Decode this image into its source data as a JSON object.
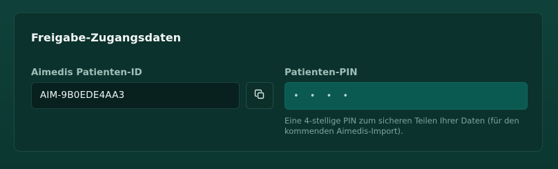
{
  "card": {
    "title": "Freigabe-Zugangsdaten"
  },
  "patient_id": {
    "label": "Aimedis Patienten-ID",
    "value": "AIM-9B0EDE4AA3",
    "copy_icon": "copy-icon"
  },
  "pin": {
    "label": "Patienten-PIN",
    "placeholder": "• • • •",
    "help": "Eine 4-stellige PIN zum sicheren Teilen Ihrer Daten (für den kommenden Aimedis-Import)."
  }
}
